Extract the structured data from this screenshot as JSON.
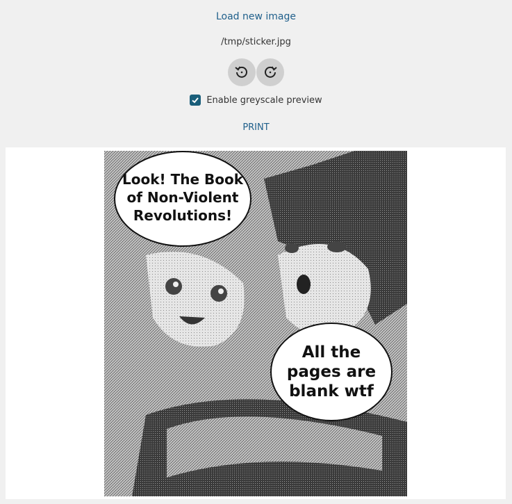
{
  "controls": {
    "load_label": "Load new image",
    "file_path": "/tmp/sticker.jpg",
    "rotate_left_icon": "rotate-left-icon",
    "rotate_right_icon": "rotate-right-icon",
    "greyscale_label": "Enable greyscale preview",
    "greyscale_checked": true,
    "print_label": "PRINT"
  },
  "preview": {
    "bubble1_lines": [
      "Look! The Book",
      "of Non-Violent",
      "Revolutions!"
    ],
    "bubble2_lines": [
      "All the",
      "pages are",
      "blank wtf"
    ]
  },
  "colors": {
    "accent": "#1f5f8b",
    "checkbox": "#1a5e7a",
    "background": "#f0f0f0"
  }
}
